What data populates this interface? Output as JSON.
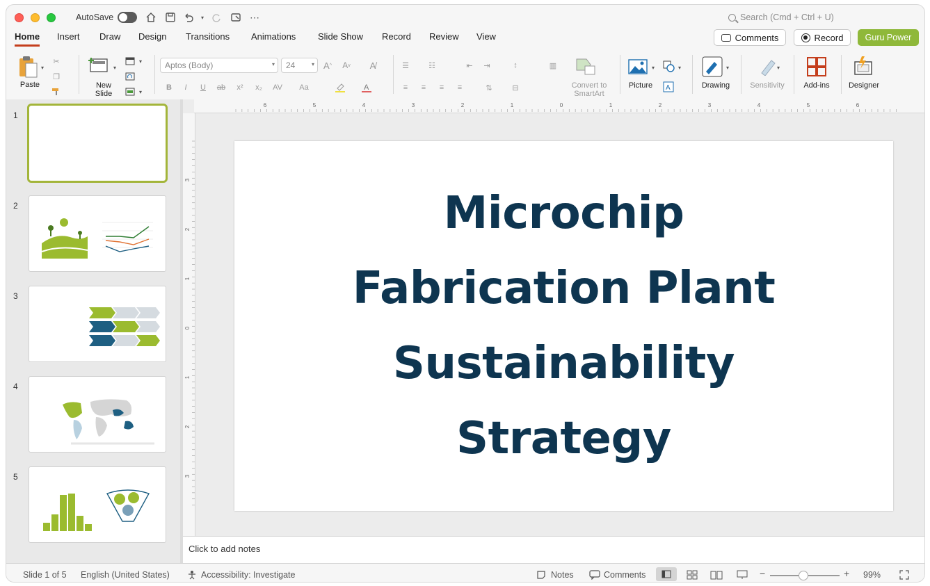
{
  "window": {
    "autosave_label": "AutoSave",
    "search_placeholder": "Search (Cmd + Ctrl + U)"
  },
  "tabs": [
    "Home",
    "Insert",
    "Draw",
    "Design",
    "Transitions",
    "Animations",
    "Slide Show",
    "Record",
    "Review",
    "View"
  ],
  "active_tab": "Home",
  "header_buttons": {
    "comments": "Comments",
    "record": "Record",
    "guru": "Guru Power"
  },
  "ribbon": {
    "paste": "Paste",
    "new_slide": "New\nSlide",
    "font_name": "Aptos (Body)",
    "font_size": "24",
    "convert_smartart": "Convert to\nSmartArt",
    "picture": "Picture",
    "drawing": "Drawing",
    "sensitivity": "Sensitivity",
    "addins": "Add-ins",
    "designer": "Designer"
  },
  "ruler": {
    "h_ticks": [
      "6",
      "5",
      "4",
      "3",
      "2",
      "1",
      "0",
      "1",
      "2",
      "3",
      "4",
      "5",
      "6"
    ],
    "v_ticks": [
      "3",
      "2",
      "1",
      "0",
      "1",
      "2",
      "3"
    ]
  },
  "thumbnails": [
    {
      "number": "1"
    },
    {
      "number": "2"
    },
    {
      "number": "3"
    },
    {
      "number": "4"
    },
    {
      "number": "5"
    }
  ],
  "slide": {
    "title": "Microchip Fabrication Plant Sustainability Strategy"
  },
  "notes_placeholder": "Click to add notes",
  "status": {
    "slide_count": "Slide 1 of 5",
    "language": "English (United States)",
    "accessibility": "Accessibility: Investigate",
    "notes": "Notes",
    "comments": "Comments",
    "zoom": "99%"
  },
  "colors": {
    "accent": "#c43e1c",
    "guru_green": "#8fb83a",
    "title_navy": "#0e3550",
    "thumb_green": "#9bbb2f",
    "thumb_blue": "#1e5f82"
  }
}
